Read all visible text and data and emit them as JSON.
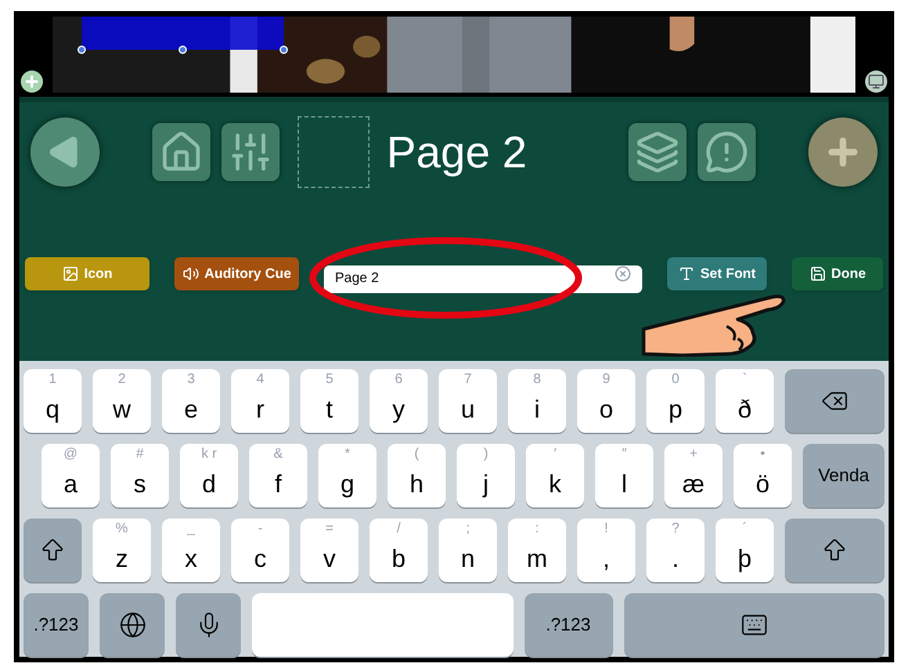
{
  "toolbar": {
    "left": [
      {
        "kind": "back"
      },
      {
        "kind": "home"
      },
      {
        "kind": "settings"
      }
    ],
    "title": "Page 2",
    "right": [
      {
        "kind": "cards"
      },
      {
        "kind": "alert"
      },
      {
        "kind": "add"
      }
    ]
  },
  "actions": [
    {
      "kind": "icon",
      "label": "Icon"
    },
    {
      "kind": "sound",
      "label": "Auditory Cue"
    },
    {
      "kind": "field",
      "value": "Page 2"
    },
    {
      "kind": "font",
      "label": "Set Font"
    },
    {
      "kind": "done",
      "label": "Done"
    }
  ],
  "keyboard": {
    "rows": [
      [
        {
          "kind": "letter",
          "hint": "1",
          "label": "q"
        },
        {
          "kind": "letter",
          "hint": "2",
          "label": "w"
        },
        {
          "kind": "letter",
          "hint": "3",
          "label": "e"
        },
        {
          "kind": "letter",
          "hint": "4",
          "label": "r"
        },
        {
          "kind": "letter",
          "hint": "5",
          "label": "t"
        },
        {
          "kind": "letter",
          "hint": "6",
          "label": "y"
        },
        {
          "kind": "letter",
          "hint": "7",
          "label": "u"
        },
        {
          "kind": "letter",
          "hint": "8",
          "label": "i"
        },
        {
          "kind": "letter",
          "hint": "9",
          "label": "o"
        },
        {
          "kind": "letter",
          "hint": "0",
          "label": "p"
        },
        {
          "kind": "letter",
          "hint": "`",
          "label": "ð"
        },
        {
          "kind": "backspace"
        }
      ],
      [
        {
          "kind": "letter",
          "hint": "@",
          "label": "a"
        },
        {
          "kind": "letter",
          "hint": "#",
          "label": "s"
        },
        {
          "kind": "letter",
          "hint": "k r",
          "label": "d"
        },
        {
          "kind": "letter",
          "hint": "&",
          "label": "f"
        },
        {
          "kind": "letter",
          "hint": "*",
          "label": "g"
        },
        {
          "kind": "letter",
          "hint": "(",
          "label": "h"
        },
        {
          "kind": "letter",
          "hint": ")",
          "label": "j"
        },
        {
          "kind": "letter",
          "hint": "′",
          "label": "k"
        },
        {
          "kind": "letter",
          "hint": "″",
          "label": "l"
        },
        {
          "kind": "letter",
          "hint": "+",
          "label": "æ"
        },
        {
          "kind": "letter",
          "hint": "•",
          "label": "ö"
        },
        {
          "kind": "return",
          "label": "Venda"
        }
      ],
      [
        {
          "kind": "shift"
        },
        {
          "kind": "letter",
          "hint": "%",
          "label": "z"
        },
        {
          "kind": "letter",
          "hint": "_",
          "label": "x"
        },
        {
          "kind": "letter",
          "hint": "-",
          "label": "c"
        },
        {
          "kind": "letter",
          "hint": "=",
          "label": "v"
        },
        {
          "kind": "letter",
          "hint": "/",
          "label": "b"
        },
        {
          "kind": "letter",
          "hint": ";",
          "label": "n"
        },
        {
          "kind": "letter",
          "hint": ":",
          "label": "m"
        },
        {
          "kind": "letter",
          "hint": "!",
          "label": ","
        },
        {
          "kind": "letter",
          "hint": "?",
          "label": "."
        },
        {
          "kind": "letter",
          "hint": "´",
          "label": "þ"
        },
        {
          "kind": "shift"
        }
      ],
      [
        {
          "kind": "numbers",
          "label": ".?123"
        },
        {
          "kind": "globe"
        },
        {
          "kind": "mic"
        },
        {
          "kind": "space"
        },
        {
          "kind": "numbers",
          "label": ".?123"
        },
        {
          "kind": "hide"
        }
      ]
    ]
  }
}
